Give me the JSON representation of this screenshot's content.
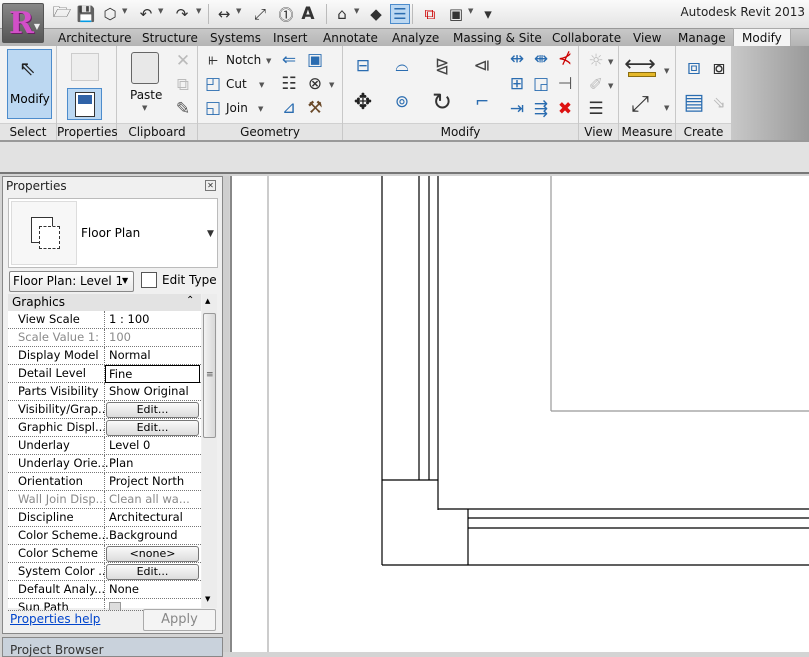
{
  "app": {
    "title": "Autodesk Revit 2013",
    "app_button_letter": "R"
  },
  "quick_access": [
    {
      "name": "open-icon",
      "glyph": "🗁"
    },
    {
      "name": "save-icon",
      "glyph": "💾"
    },
    {
      "name": "sync-icon",
      "glyph": "⬡"
    },
    {
      "name": "undo-icon",
      "glyph": "↶"
    },
    {
      "name": "redo-icon",
      "glyph": "↷"
    },
    {
      "name": "measure-icon",
      "glyph": "↔"
    },
    {
      "name": "aligned-dimension-icon",
      "glyph": "⤢"
    },
    {
      "name": "tag-icon",
      "glyph": "⓵"
    },
    {
      "name": "text-icon",
      "glyph": "A"
    },
    {
      "name": "3d-view-icon",
      "glyph": "⌂"
    },
    {
      "name": "section-icon",
      "glyph": "◆"
    },
    {
      "name": "thin-lines-icon",
      "glyph": "☰"
    },
    {
      "name": "close-hidden-windows-icon",
      "glyph": "⧉"
    },
    {
      "name": "switch-windows-icon",
      "glyph": "▣"
    },
    {
      "name": "customize-qat-icon",
      "glyph": "▾"
    }
  ],
  "tabs": [
    "Architecture",
    "Structure",
    "Systems",
    "Insert",
    "Annotate",
    "Analyze",
    "Massing & Site",
    "Collaborate",
    "View",
    "Manage",
    "Modify"
  ],
  "active_tab": "Modify",
  "ribbon": {
    "panels": [
      "Select",
      "Properties",
      "Clipboard",
      "Geometry",
      "Modify",
      "View",
      "Measure",
      "Create"
    ],
    "select": {
      "modify_label": "Modify"
    },
    "clipboard": {
      "paste_label": "Paste"
    },
    "geometry": {
      "notch_label": "Notch",
      "cut_label": "Cut",
      "join_label": "Join"
    }
  },
  "properties": {
    "title": "Properties",
    "type_name": "Floor Plan",
    "view_selector": "Floor Plan: Level 1",
    "edit_type": "Edit Type",
    "group": "Graphics",
    "rows": [
      {
        "name": "View Scale",
        "value": "1 : 100",
        "kind": "text"
      },
      {
        "name": "Scale Value    1:",
        "value": "100",
        "kind": "disabled"
      },
      {
        "name": "Display Model",
        "value": "Normal",
        "kind": "text"
      },
      {
        "name": "Detail Level",
        "value": "Fine",
        "kind": "box"
      },
      {
        "name": "Parts Visibility",
        "value": "Show Original",
        "kind": "text"
      },
      {
        "name": "Visibility/Grap...",
        "value": "Edit...",
        "kind": "button"
      },
      {
        "name": "Graphic Displ...",
        "value": "Edit...",
        "kind": "button"
      },
      {
        "name": "Underlay",
        "value": "Level 0",
        "kind": "text"
      },
      {
        "name": "Underlay Orie...",
        "value": "Plan",
        "kind": "text"
      },
      {
        "name": "Orientation",
        "value": "Project North",
        "kind": "text"
      },
      {
        "name": "Wall Join Disp...",
        "value": "Clean all wa...",
        "kind": "disabled"
      },
      {
        "name": "Discipline",
        "value": "Architectural",
        "kind": "text"
      },
      {
        "name": "Color Scheme...",
        "value": "Background",
        "kind": "text"
      },
      {
        "name": "Color Scheme",
        "value": "<none>",
        "kind": "button"
      },
      {
        "name": "System Color ...",
        "value": "Edit...",
        "kind": "button"
      },
      {
        "name": "Default Analy...",
        "value": "None",
        "kind": "text"
      },
      {
        "name": "Sun Path",
        "value": "",
        "kind": "checkbox"
      }
    ],
    "help_link": "Properties help",
    "apply_label": "Apply"
  },
  "project_browser": {
    "title": "Project Browser"
  }
}
